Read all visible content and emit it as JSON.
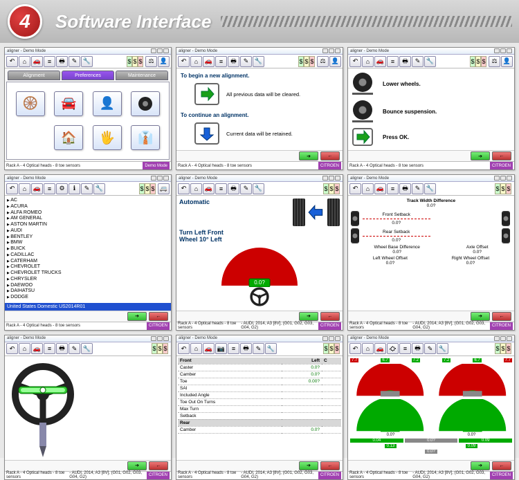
{
  "header": {
    "number": "4",
    "title": "Software Interface"
  },
  "common": {
    "window_title": "aligner - Demo Mode",
    "status_rack": "Rack A - 4 Optical heads - 8 toe sensors",
    "status_vehicle": "- AUDI, 2014, A3 [8V], (G01, G02, G03, G04, G2)",
    "status_badge": "CITROEN",
    "status_demo": "Demo Mode"
  },
  "w1": {
    "tabs": [
      "Alignment",
      "Preferences",
      "Maintenance"
    ],
    "icons": [
      "wheel",
      "car",
      "person",
      "tire",
      "house",
      "hand",
      "tech"
    ]
  },
  "w2": {
    "lines": {
      "h1": "To begin a new alignment.",
      "l1": "All previous data will be cleared.",
      "h2": "To continue an alignment.",
      "l2": "Current data will be retained."
    }
  },
  "w3": {
    "lines": {
      "l1": "Lower wheels.",
      "l2": "Bounce suspension.",
      "l3": "Press OK."
    }
  },
  "w4": {
    "makes": [
      "AC",
      "ACURA",
      "ALFA ROMEO",
      "AM GENERAL",
      "ASTON MARTIN",
      "AUDI",
      "BENTLEY",
      "BMW",
      "BUICK",
      "CADILLAC",
      "CATERHAM",
      "CHEVROLET",
      "CHEVROLET TRUCKS",
      "CHRYSLER",
      "DAEWOO",
      "DAIHATSU",
      "DODGE"
    ],
    "selected": "United States Domestic  US2014R01"
  },
  "w5": {
    "mode": "Automatic",
    "instr1": "Turn Left Front",
    "instr2": "Wheel 10° Left",
    "reading": "0.0?"
  },
  "w8": {
    "cols": [
      "Front",
      "Left",
      "C"
    ],
    "rows": [
      [
        "Caster",
        "0.0?",
        ""
      ],
      [
        "Camber",
        "0.0?",
        ""
      ],
      [
        "Toe",
        "0.00?",
        ""
      ],
      [
        "SAI",
        "",
        ""
      ],
      [
        "Included Angle",
        "",
        ""
      ],
      [
        "Toe Out On Turns",
        "",
        ""
      ],
      [
        "Max Turn",
        "",
        ""
      ],
      [
        "Setback",
        "",
        ""
      ]
    ],
    "rear_hdr": "Rear",
    "rear_rows": [
      [
        "Camber",
        "0.0?",
        ""
      ]
    ]
  },
  "w6": {
    "labels": {
      "twd": "Track Width Difference",
      "fs": "Front Setback",
      "wbd": "Wheel Base Difference",
      "ao": "Axle Offset",
      "rs": "Rear Setback",
      "lwo": "Left Wheel Offset",
      "rwo": "Right Wheel Offset"
    },
    "zero": "0.0?"
  },
  "w9": {
    "top_vals": [
      "7.7",
      "6.7",
      "7.2",
      "7.2",
      "6.7",
      "7.7"
    ],
    "zero": "0.0?",
    "bottom": [
      "0.13",
      "0.09",
      "0.0?"
    ],
    "small": [
      "0.04",
      "0.0?",
      "0.09"
    ]
  }
}
